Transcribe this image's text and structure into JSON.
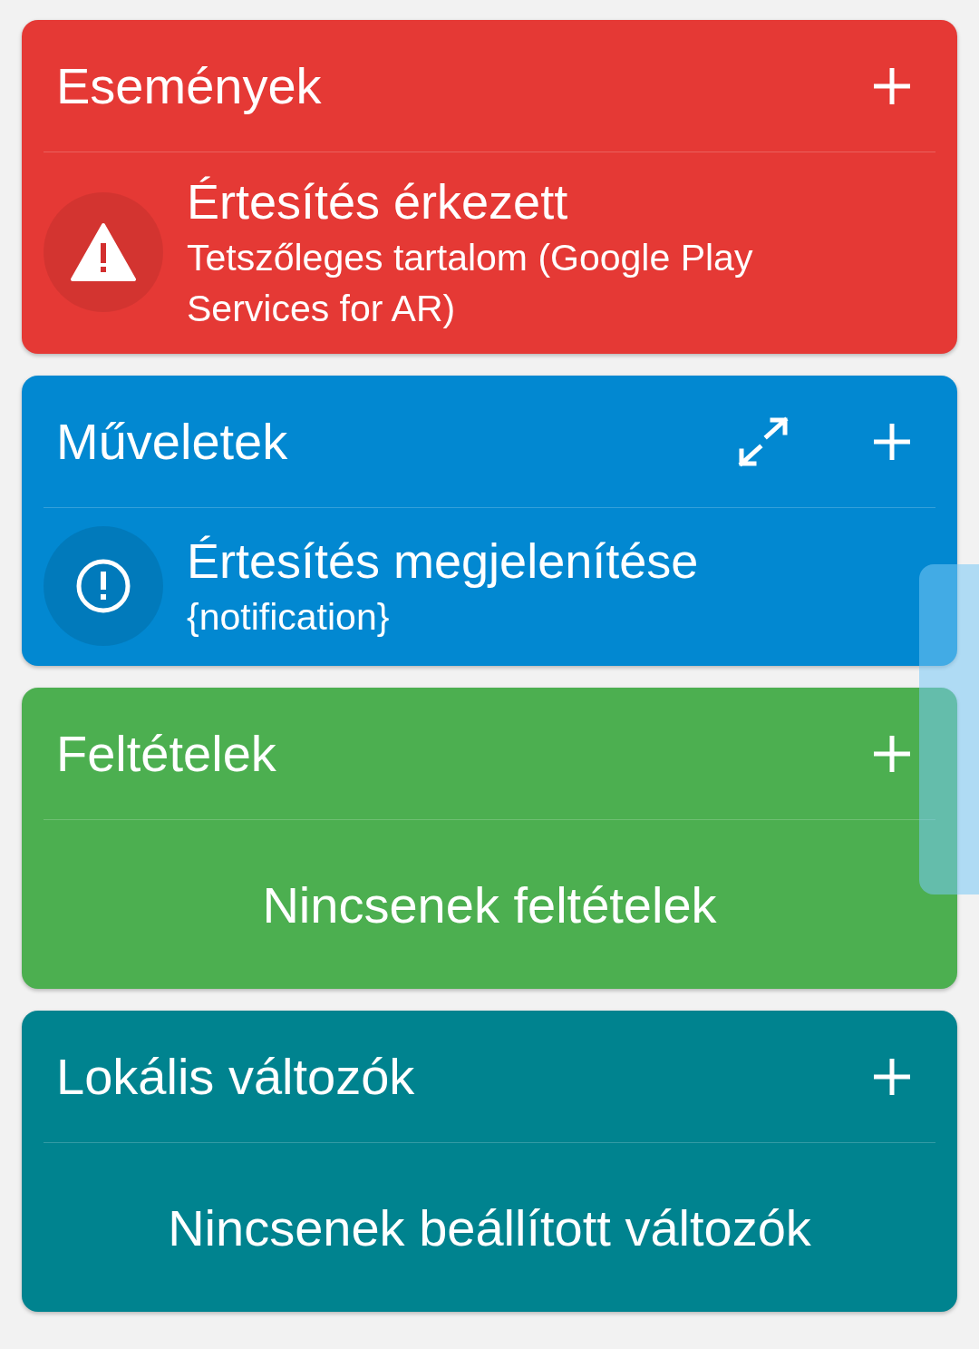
{
  "sections": [
    {
      "title": "Események",
      "color": "#e53935",
      "show_expand": false,
      "items": [
        {
          "kind": "warning",
          "title": "Értesítés érkezett",
          "subtitle": "Tetszőleges tartalom (Google Play Services for AR)"
        }
      ]
    },
    {
      "title": "Műveletek",
      "color": "#0288d1",
      "show_expand": true,
      "items": [
        {
          "kind": "info",
          "title": "Értesítés megjelenítése",
          "subtitle": "{notification}"
        }
      ]
    },
    {
      "title": "Feltételek",
      "color": "#4caf50",
      "show_expand": false,
      "empty_text": "Nincsenek feltételek"
    },
    {
      "title": "Lokális változók",
      "color": "#00838f",
      "show_expand": false,
      "empty_text": "Nincsenek beállított változók"
    }
  ]
}
